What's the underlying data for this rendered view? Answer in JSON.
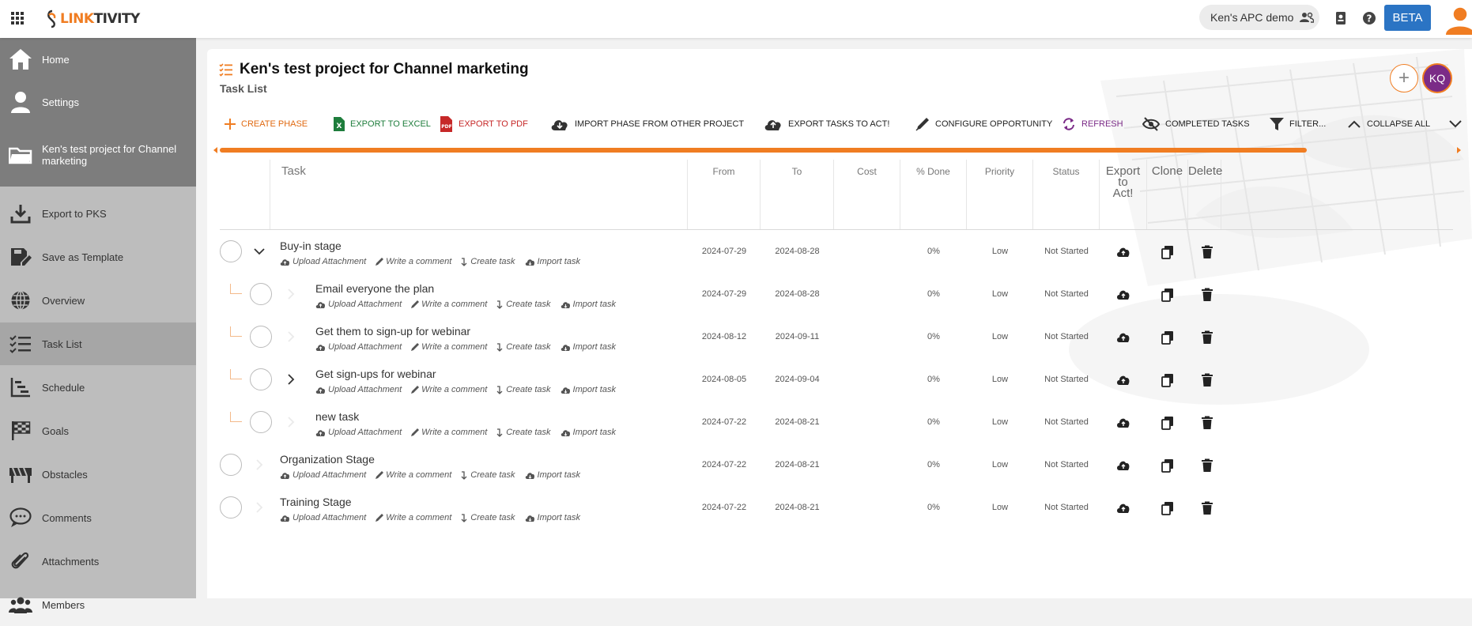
{
  "topbar": {
    "logo_mark": "LINK",
    "logo_rest": "TIVITY",
    "account_label": "Ken's APC demo",
    "beta_label": "BETA"
  },
  "sidebar": {
    "items": [
      {
        "label": "Home",
        "icon": "home-icon"
      },
      {
        "label": "Settings",
        "icon": "person-icon"
      },
      {
        "label": "Ken's test project for Channel marketing",
        "icon": "folder-icon"
      },
      {
        "label": "Export to PKS",
        "icon": "download-icon"
      },
      {
        "label": "Save as Template",
        "icon": "save-template-icon"
      },
      {
        "label": "Overview",
        "icon": "globe-icon"
      },
      {
        "label": "Task List",
        "icon": "checklist-icon"
      },
      {
        "label": "Schedule",
        "icon": "schedule-icon"
      },
      {
        "label": "Goals",
        "icon": "checkered-flag-icon"
      },
      {
        "label": "Obstacles",
        "icon": "barrier-icon"
      },
      {
        "label": "Comments",
        "icon": "comment-icon"
      },
      {
        "label": "Attachments",
        "icon": "paperclip-icon"
      },
      {
        "label": "Members",
        "icon": "members-icon"
      }
    ]
  },
  "page": {
    "project_title": "Ken's test project for Channel marketing",
    "subtitle": "Task List",
    "plus_label": "+",
    "avatar_initials": "KQ"
  },
  "toolbar": {
    "create_phase": "CREATE PHASE",
    "export_excel": "EXPORT TO EXCEL",
    "export_pdf": "EXPORT TO PDF",
    "import_phase": "IMPORT PHASE FROM OTHER PROJECT",
    "export_act": "EXPORT TASKS TO ACT!",
    "configure": "CONFIGURE OPPORTUNITY",
    "refresh": "REFRESH",
    "completed": "COMPLETED TASKS",
    "filter": "FILTER...",
    "collapse": "COLLAPSE ALL"
  },
  "colors": {
    "accent": "#f07d22",
    "excel": "#1e7d3c",
    "pdf": "#c62828",
    "refresh": "#7b2b87",
    "beta": "#2b74c4"
  },
  "table": {
    "headers": {
      "task": "Task",
      "from": "From",
      "to": "To",
      "cost": "Cost",
      "done": "% Done",
      "priority": "Priority",
      "status": "Status",
      "export_l1": "Export",
      "export_l2": "to",
      "export_l3": "Act!",
      "clone": "Clone",
      "delete": "Delete"
    },
    "action_labels": {
      "upload": "Upload Attachment",
      "comment": "Write a comment",
      "create": "Create task",
      "import": "Import task"
    },
    "rows": [
      {
        "name": "Buy-in stage",
        "from": "2024-07-29",
        "to": "2024-08-28",
        "cost": "",
        "done": "0%",
        "priority": "Low",
        "status": "Not Started"
      },
      {
        "name": "Email everyone the plan",
        "from": "2024-07-29",
        "to": "2024-08-28",
        "cost": "",
        "done": "0%",
        "priority": "Low",
        "status": "Not Started"
      },
      {
        "name": "Get them to sign-up for webinar",
        "from": "2024-08-12",
        "to": "2024-09-11",
        "cost": "",
        "done": "0%",
        "priority": "Low",
        "status": "Not Started"
      },
      {
        "name": "Get sign-ups for webinar",
        "from": "2024-08-05",
        "to": "2024-09-04",
        "cost": "",
        "done": "0%",
        "priority": "Low",
        "status": "Not Started"
      },
      {
        "name": "new task",
        "from": "2024-07-22",
        "to": "2024-08-21",
        "cost": "",
        "done": "0%",
        "priority": "Low",
        "status": "Not Started"
      },
      {
        "name": "Organization Stage",
        "from": "2024-07-22",
        "to": "2024-08-21",
        "cost": "",
        "done": "0%",
        "priority": "Low",
        "status": "Not Started"
      },
      {
        "name": "Training Stage",
        "from": "2024-07-22",
        "to": "2024-08-21",
        "cost": "",
        "done": "0%",
        "priority": "Low",
        "status": "Not Started"
      }
    ]
  }
}
